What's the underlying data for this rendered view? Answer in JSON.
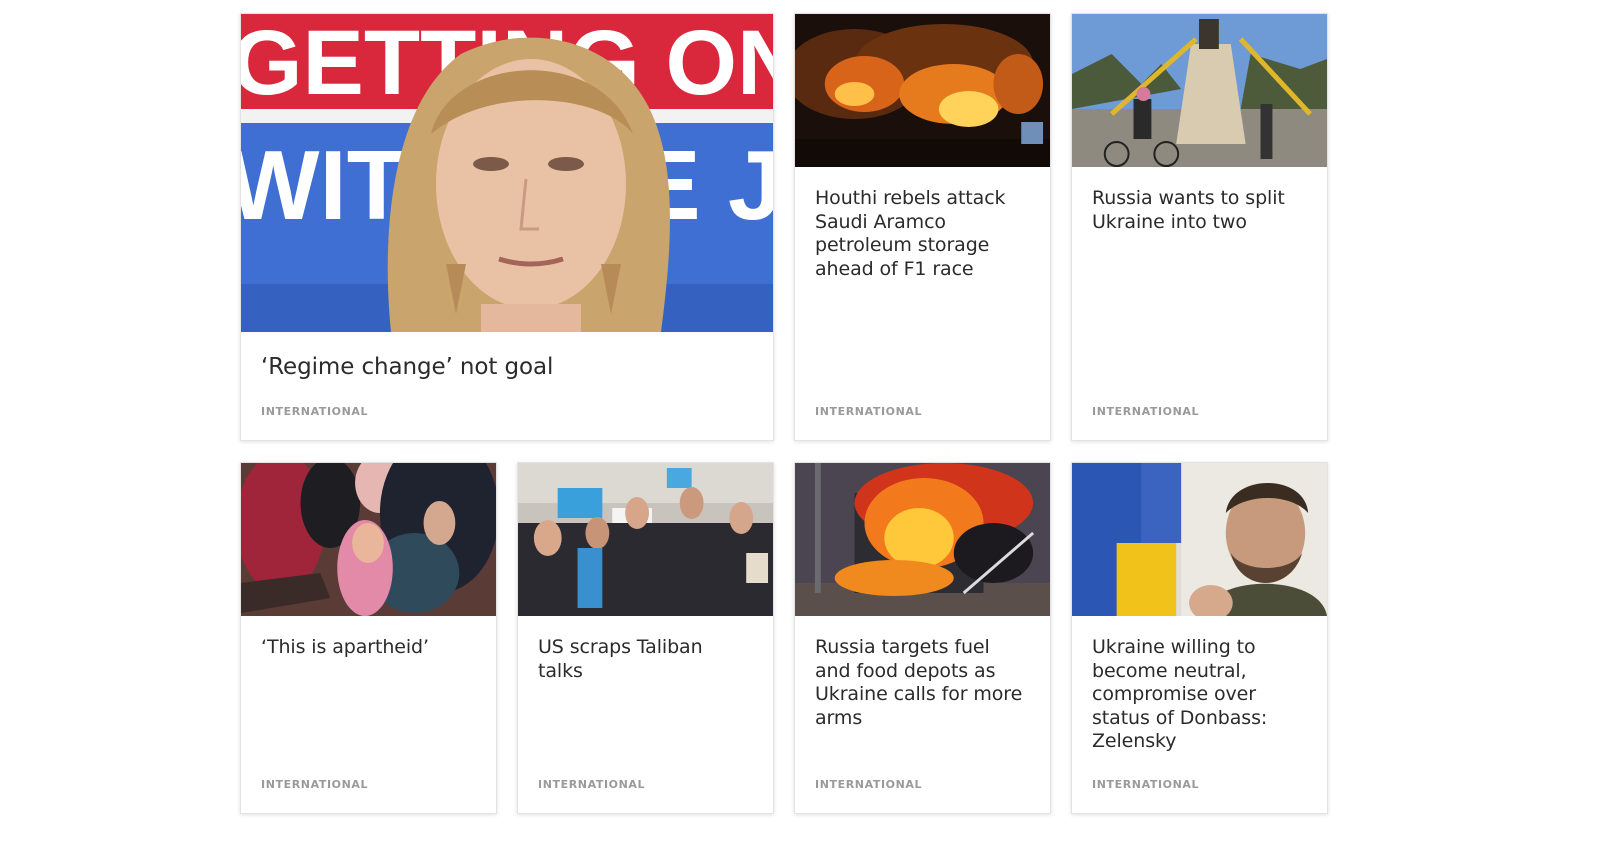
{
  "articles": [
    {
      "headline": "‘Regime change’ not goal",
      "category": "INTERNATIONAL",
      "image": "woman-speaker-photo",
      "featured": true
    },
    {
      "headline": "Houthi rebels attack Saudi Aramco petroleum storage ahead of F1 race",
      "category": "INTERNATIONAL",
      "image": "oil-fire-night-photo"
    },
    {
      "headline": "Russia wants to split Ukraine into two",
      "category": "INTERNATIONAL",
      "image": "statue-sandbags-photo"
    },
    {
      "headline": "‘This is apartheid’",
      "category": "INTERNATIONAL",
      "image": "crowd-women-child-photo"
    },
    {
      "headline": "US scraps Taliban talks",
      "category": "INTERNATIONAL",
      "image": "women-protest-photo"
    },
    {
      "headline": "Russia targets fuel and food depots as Ukraine calls for more arms",
      "category": "INTERNATIONAL",
      "image": "fuel-depot-fire-photo"
    },
    {
      "headline": "Ukraine willing to become neutral, compromise over status of Donbass: Zelensky",
      "category": "INTERNATIONAL",
      "image": "zelensky-portrait-photo"
    }
  ],
  "image_banner_text": {
    "line1": "GETTING ON",
    "line2": "WITH THE JOB"
  }
}
